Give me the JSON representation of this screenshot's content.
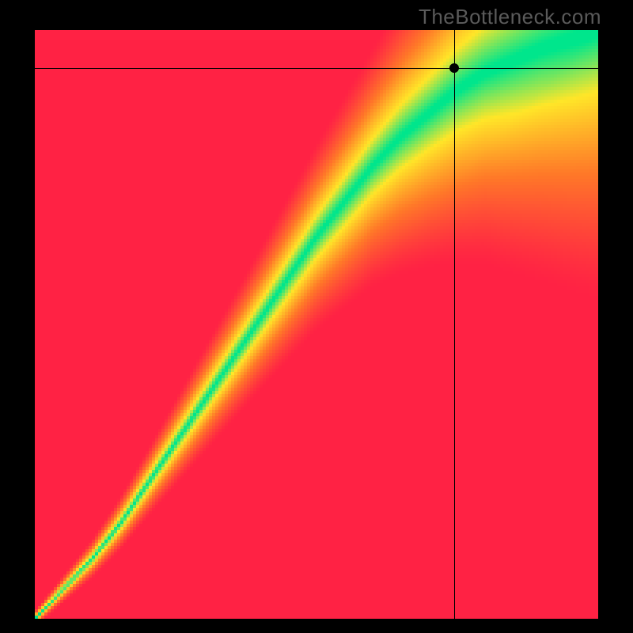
{
  "watermark": "TheBottleneck.com",
  "chart_data": {
    "type": "heatmap",
    "title": "",
    "xlabel": "",
    "ylabel": "",
    "xlim": [
      0,
      1
    ],
    "ylim": [
      0,
      1
    ],
    "crosshair": {
      "x": 0.745,
      "y": 0.935
    },
    "optimal_curve": [
      [
        0.0,
        0.0
      ],
      [
        0.05,
        0.05
      ],
      [
        0.1,
        0.1
      ],
      [
        0.15,
        0.16
      ],
      [
        0.2,
        0.23
      ],
      [
        0.25,
        0.3
      ],
      [
        0.3,
        0.37
      ],
      [
        0.35,
        0.44
      ],
      [
        0.4,
        0.51
      ],
      [
        0.45,
        0.58
      ],
      [
        0.5,
        0.65
      ],
      [
        0.55,
        0.71
      ],
      [
        0.6,
        0.77
      ],
      [
        0.65,
        0.82
      ],
      [
        0.7,
        0.86
      ],
      [
        0.75,
        0.9
      ],
      [
        0.8,
        0.93
      ],
      [
        0.85,
        0.95
      ],
      [
        0.9,
        0.97
      ],
      [
        0.95,
        0.985
      ],
      [
        1.0,
        1.0
      ]
    ],
    "band_width_curve": [
      [
        0.0,
        0.004
      ],
      [
        0.1,
        0.01
      ],
      [
        0.2,
        0.018
      ],
      [
        0.3,
        0.028
      ],
      [
        0.4,
        0.038
      ],
      [
        0.5,
        0.05
      ],
      [
        0.6,
        0.065
      ],
      [
        0.7,
        0.085
      ],
      [
        0.8,
        0.11
      ],
      [
        0.9,
        0.14
      ],
      [
        1.0,
        0.17
      ]
    ],
    "color_stops": [
      {
        "t": 0.0,
        "rgb": [
          255,
          34,
          68
        ],
        "label": "bottleneck-high"
      },
      {
        "t": 0.35,
        "rgb": [
          255,
          120,
          40
        ],
        "label": "bottleneck-med"
      },
      {
        "t": 0.7,
        "rgb": [
          255,
          230,
          40
        ],
        "label": "bottleneck-low"
      },
      {
        "t": 0.97,
        "rgb": [
          0,
          230,
          140
        ],
        "label": "optimal"
      }
    ]
  }
}
